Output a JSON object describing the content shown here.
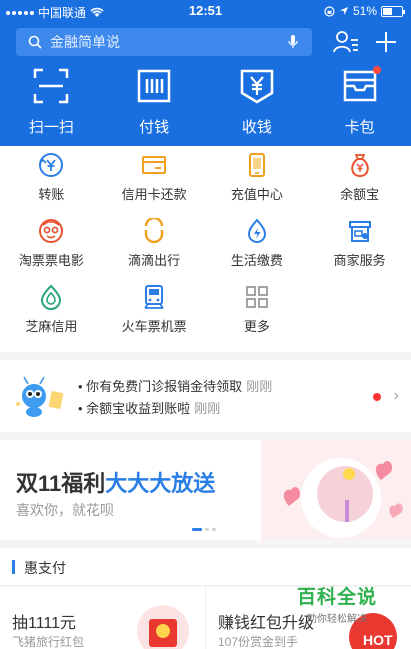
{
  "status_bar": {
    "carrier": "中国联通",
    "time": "12:51",
    "battery": "51%",
    "battery_level": 0.51
  },
  "search": {
    "placeholder": "金融简单说"
  },
  "top_actions": [
    {
      "label": "扫一扫",
      "icon": "scan-icon"
    },
    {
      "label": "付钱",
      "icon": "pay-barcode-icon"
    },
    {
      "label": "收钱",
      "icon": "receive-money-icon"
    },
    {
      "label": "卡包",
      "icon": "card-wallet-icon"
    }
  ],
  "grid": [
    {
      "label": "转账",
      "icon": "transfer-icon"
    },
    {
      "label": "信用卡还款",
      "icon": "credit-card-icon"
    },
    {
      "label": "充值中心",
      "icon": "phone-recharge-icon"
    },
    {
      "label": "余额宝",
      "icon": "money-bag-icon"
    },
    {
      "label": "淘票票电影",
      "icon": "movie-icon"
    },
    {
      "label": "滴滴出行",
      "icon": "didi-icon"
    },
    {
      "label": "生活缴费",
      "icon": "utility-bill-icon"
    },
    {
      "label": "商家服务",
      "icon": "merchant-icon"
    },
    {
      "label": "芝麻信用",
      "icon": "sesame-credit-icon"
    },
    {
      "label": "火车票机票",
      "icon": "train-ticket-icon"
    },
    {
      "label": "更多",
      "icon": "more-grid-icon"
    }
  ],
  "notice": {
    "line1": "你有免费门诊报销金待领取",
    "line1_time": "刚刚",
    "line2": "余额宝收益到账啦",
    "line2_time": "刚刚"
  },
  "banner": {
    "title_part1": "双11福利",
    "title_part2": "大大大放送",
    "subtitle": "喜欢你，就花呗"
  },
  "section": {
    "title": "惠支付"
  },
  "cards": [
    {
      "title": "抽1111元",
      "subtitle": "飞猪旅行红包"
    },
    {
      "title": "赚钱红包升级",
      "subtitle": "107份赏金到手"
    }
  ],
  "watermark": {
    "line1": "百科全说",
    "line2": "助你轻松解决"
  },
  "colors": {
    "header_blue": "#1a6fe0",
    "accent": "#2b7ee6",
    "badge": "#ff4a3d"
  }
}
